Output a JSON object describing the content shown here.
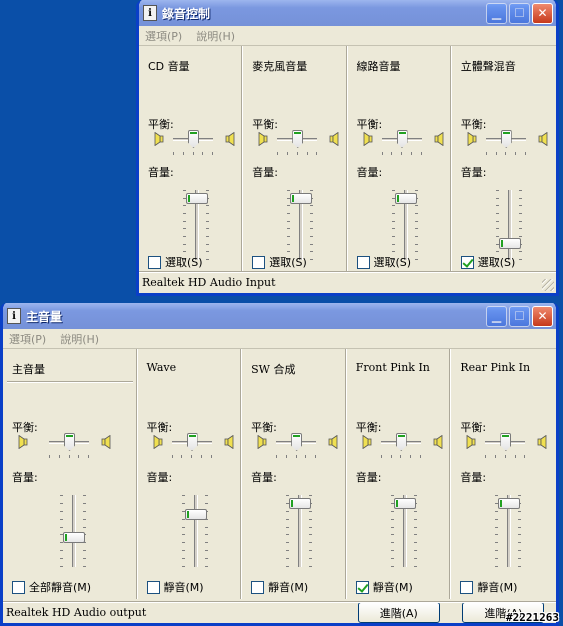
{
  "recording_window": {
    "title": "錄音控制",
    "menu": [
      "選項(P)",
      "說明(H)"
    ],
    "balance_label": "平衡:",
    "volume_label": "音量:",
    "channels": [
      {
        "name": "CD 音量",
        "select_label": "選取(S)",
        "selected": false,
        "balance": 0.5,
        "volume": 0.95
      },
      {
        "name": "麥克風音量",
        "select_label": "選取(S)",
        "selected": false,
        "balance": 0.5,
        "volume": 0.95
      },
      {
        "name": "線路音量",
        "select_label": "選取(S)",
        "selected": false,
        "balance": 0.5,
        "volume": 0.95
      },
      {
        "name": "立體聲混音",
        "select_label": "選取(S)",
        "selected": true,
        "balance": 0.5,
        "volume": 0.2
      }
    ],
    "status": "Realtek HD Audio Input"
  },
  "playback_window": {
    "title": "主音量",
    "menu": [
      "選項(P)",
      "說明(H)"
    ],
    "balance_label": "平衡:",
    "volume_label": "音量:",
    "master": {
      "name": "主音量",
      "mute_label": "全部靜音(M)",
      "muted": false,
      "balance": 0.5,
      "volume": 0.4
    },
    "channels": [
      {
        "name": "Wave",
        "mute_label": "靜音(M)",
        "muted": false,
        "balance": 0.5,
        "volume": 0.78
      },
      {
        "name": "SW 合成",
        "mute_label": "靜音(M)",
        "muted": false,
        "balance": 0.5,
        "volume": 0.95
      },
      {
        "name": "Front Pink In",
        "mute_label": "靜音(M)",
        "muted": true,
        "balance": 0.5,
        "volume": 0.95,
        "advanced": "進階(A)"
      },
      {
        "name": "Rear Pink In",
        "mute_label": "靜音(M)",
        "muted": false,
        "balance": 0.5,
        "volume": 0.95,
        "advanced": "進階(A)"
      }
    ],
    "status": "Realtek HD Audio output"
  },
  "watermark": "#2221263",
  "colors": {
    "desktop": "#0a4fa8",
    "window_face": "#ece9d8",
    "title_active": "#0550d6",
    "thumb_accent": "#21a121"
  }
}
